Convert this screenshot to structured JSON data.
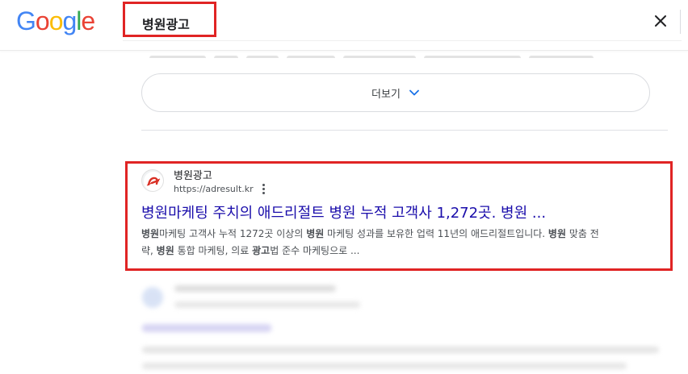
{
  "header": {
    "logo_text": "Google",
    "search_query": "병원광고",
    "clear_label": "×"
  },
  "more": {
    "label": "더보기"
  },
  "result": {
    "site_name": "병원광고",
    "url": "https://adresult.kr",
    "title": "병원마케팅 주치의 애드리절트 병원 누적 고객사 1,272곳. 병원 ...",
    "snippet": {
      "line1_parts": [
        "병원",
        "마케팅 고객사 누적 1272곳 이상의 ",
        "병원",
        " 마케팅 성과를 보유한 업력 11년의 애드리절트입니다. ",
        "병원",
        " 맞춤 전"
      ],
      "line2_parts": [
        "략, ",
        "병원",
        " 통합 마케팅, 의료 ",
        "광고",
        "법 준수 마케팅으로 ..."
      ]
    }
  },
  "colors": {
    "highlight_red": "#e02424",
    "link_blue": "#1a0dab",
    "logo_blue": "#4285F4",
    "logo_red": "#EA4335",
    "logo_yellow": "#FBBC05",
    "logo_green": "#34A853"
  }
}
